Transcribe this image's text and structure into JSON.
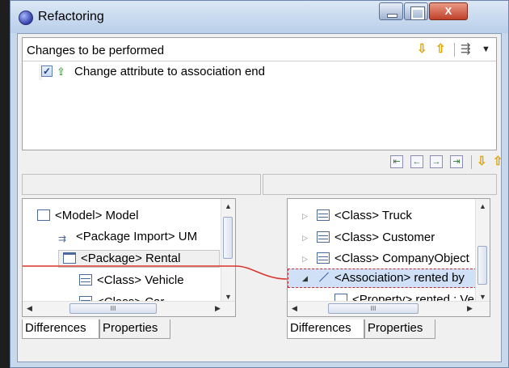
{
  "window": {
    "title": "Refactoring",
    "close_symbol": "X"
  },
  "changes": {
    "title": "Changes to be performed",
    "items": [
      {
        "label": "Change attribute to association end",
        "checked": true
      }
    ]
  },
  "left_tree": {
    "nodes": [
      {
        "label": "<Model> Model",
        "icon": "model-icon"
      },
      {
        "label": "<Package Import> UM",
        "icon": "package-import-icon"
      },
      {
        "label": "<Package> Rental",
        "icon": "package-icon",
        "selected": true
      },
      {
        "label": "<Class> Vehicle",
        "icon": "class-icon"
      },
      {
        "label": "<Class> Car",
        "icon": "class-icon"
      }
    ]
  },
  "right_tree": {
    "nodes": [
      {
        "label": "<Class> Truck",
        "icon": "class-icon"
      },
      {
        "label": "<Class> Customer",
        "icon": "class-icon"
      },
      {
        "label": "<Class> CompanyObject",
        "icon": "class-icon"
      },
      {
        "label": "<Association> rented by",
        "icon": "association-icon",
        "highlighted": true
      },
      {
        "label": "<Property> rented : Ve",
        "icon": "property-icon"
      }
    ]
  },
  "tabs": {
    "left": [
      "Differences",
      "Properties"
    ],
    "right": [
      "Differences",
      "Properties"
    ]
  },
  "scroll_thumb_glyph": "III",
  "colors": {
    "diff_line": "#d9342b",
    "highlight_fill": "#cfe0f7",
    "highlight_border": "#c03030"
  }
}
